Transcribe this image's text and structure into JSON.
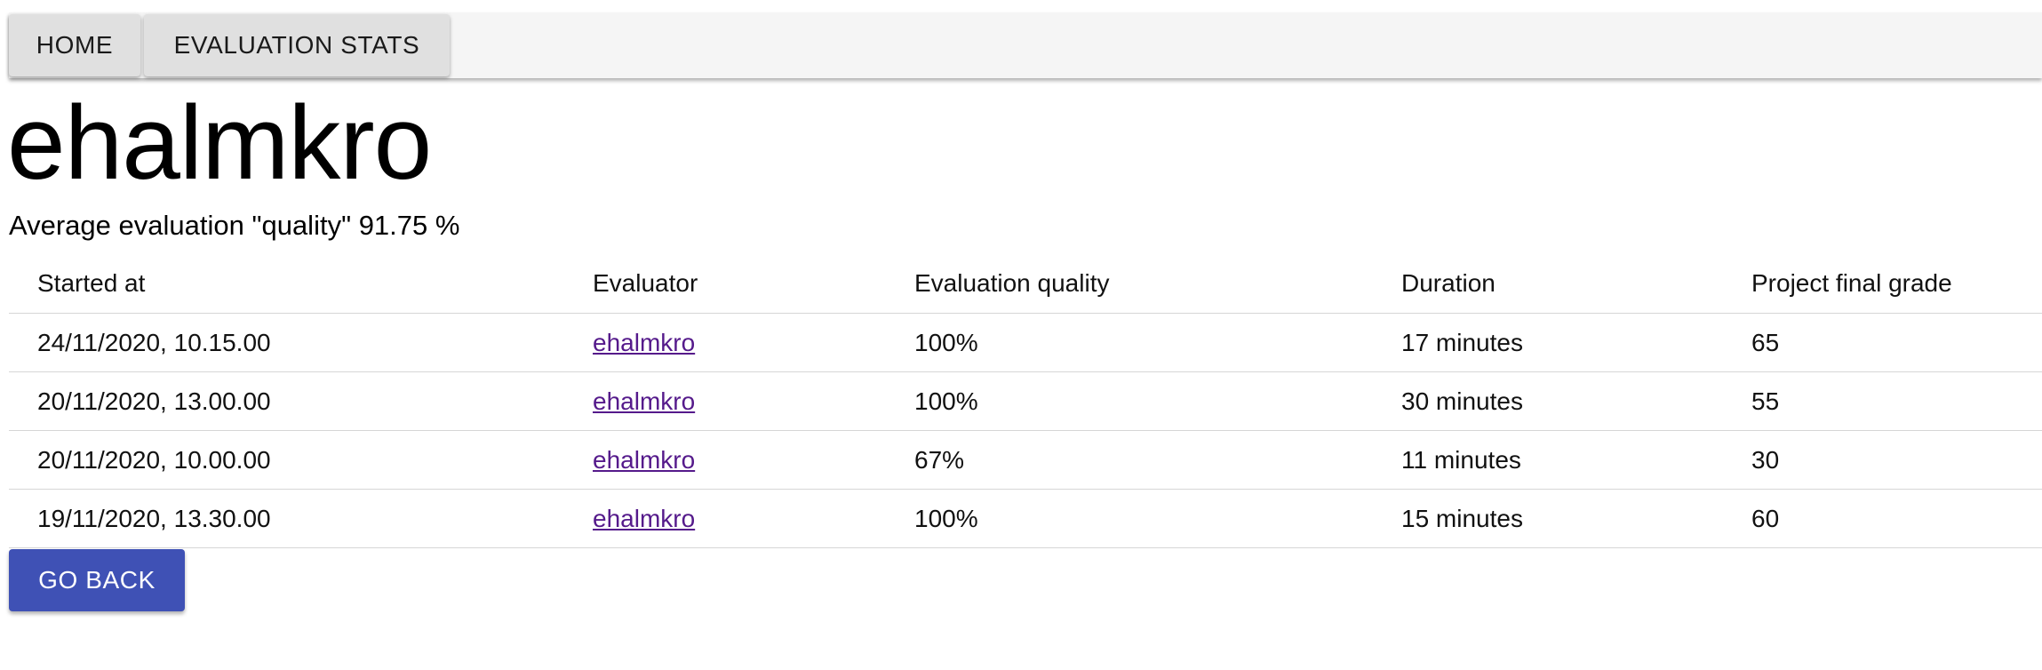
{
  "nav": {
    "home_label": "HOME",
    "stats_label": "EVALUATION STATS"
  },
  "page": {
    "title": "ehalmkro",
    "average_quality": "Average evaluation \"quality\" 91.75 %"
  },
  "table": {
    "headers": {
      "started_at": "Started at",
      "evaluator": "Evaluator",
      "quality": "Evaluation quality",
      "duration": "Duration",
      "final_grade": "Project final grade"
    },
    "rows": [
      {
        "started_at": "24/11/2020, 10.15.00",
        "evaluator": "ehalmkro",
        "quality": "100%",
        "duration": "17 minutes",
        "final_grade": "65"
      },
      {
        "started_at": "20/11/2020, 13.00.00",
        "evaluator": "ehalmkro",
        "quality": "100%",
        "duration": "30 minutes",
        "final_grade": "55"
      },
      {
        "started_at": "20/11/2020, 10.00.00",
        "evaluator": "ehalmkro",
        "quality": "67%",
        "duration": "11 minutes",
        "final_grade": "30"
      },
      {
        "started_at": "19/11/2020, 13.30.00",
        "evaluator": "ehalmkro",
        "quality": "100%",
        "duration": "15 minutes",
        "final_grade": "60"
      }
    ]
  },
  "actions": {
    "go_back_label": "GO BACK"
  },
  "colors": {
    "primary": "#3f51b5",
    "appbar": "#f5f5f5",
    "nav_button": "#e0e0e0",
    "link_visited": "#551a8b"
  }
}
